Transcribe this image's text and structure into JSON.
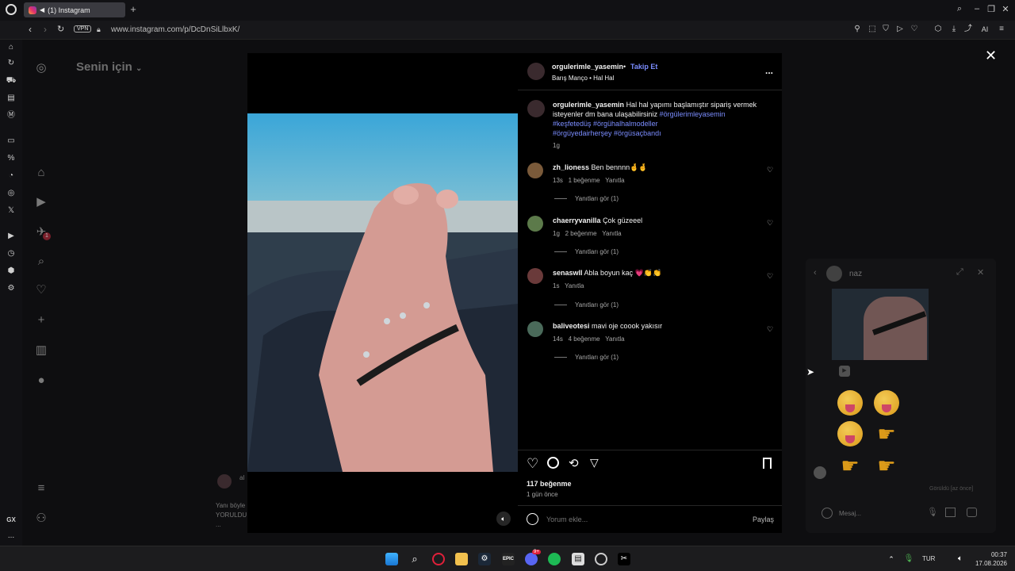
{
  "browser": {
    "tab_title": "(1) Instagram",
    "new_tab": "+",
    "vpn_badge": "VPN",
    "url": "www.instagram.com/p/DcDnSiLlbxK/",
    "toolbar_ai": "AI",
    "sidebar_gx": "GX",
    "sidebar_more": "..."
  },
  "instagram": {
    "feed_title": "Senin için",
    "bg_comment_user": "al",
    "bg_comment_text_1": "Yanı böyle",
    "bg_comment_text_2": "YORULDU",
    "bg_comment_text_3": "...",
    "notification_count": "1"
  },
  "post": {
    "author": "orgulerimle_yasemin",
    "dot": "•",
    "follow_label": "Takip Et",
    "audio": "Barış Manço • Hal Hal",
    "more_label": "...",
    "caption_user": "orgulerimle_yasemin",
    "caption_line1": "Hal hal yapımı başlamıştır sipariş vermek",
    "caption_line2_text": "isteyenler dm bana ulaşabilirsiniz",
    "caption_tag1": "#örgülerimleyasemin",
    "caption_tags_line3": "#keşfetedüş #örgühalhalmodeller",
    "caption_tags_line4": "#örgüyedairherşey #örgüsaçbandı",
    "caption_time": "1g",
    "likes": "117 beğenme",
    "posted": "1 gün önce",
    "comment_placeholder": "Yorum ekle...",
    "share_label": "Paylaş",
    "comments": [
      {
        "user": "zh_lioness",
        "text": "Ben bennnn🤞🤞",
        "time": "13s",
        "likes": "1 beğenme",
        "reply": "Yanıtla",
        "view_replies": "Yanıtları gör (1)"
      },
      {
        "user": "chaerryvanilla",
        "text": "Çok güzeeel",
        "time": "1g",
        "likes": "2 beğenme",
        "reply": "Yanıtla",
        "view_replies": "Yanıtları gör (1)"
      },
      {
        "user": "senaswll",
        "text": "Abla boyun kaç 💗👏👏",
        "time": "1s",
        "likes": "",
        "reply": "Yanıtla",
        "view_replies": "Yanıtları gör (1)"
      },
      {
        "user": "baliveotesi",
        "text": "mavi oje coook yakısır",
        "time": "14s",
        "likes": "4 beğenme",
        "reply": "Yanıtla",
        "view_replies": "Yanıtları gör (1)"
      }
    ]
  },
  "chat": {
    "name": "naz",
    "seen": "Görüldü [az önce]",
    "message_placeholder": "Mesaj..."
  },
  "taskbar": {
    "lang": "TUR",
    "time": "00:37",
    "date": "17.08.2026",
    "discord_badge": "9+"
  }
}
